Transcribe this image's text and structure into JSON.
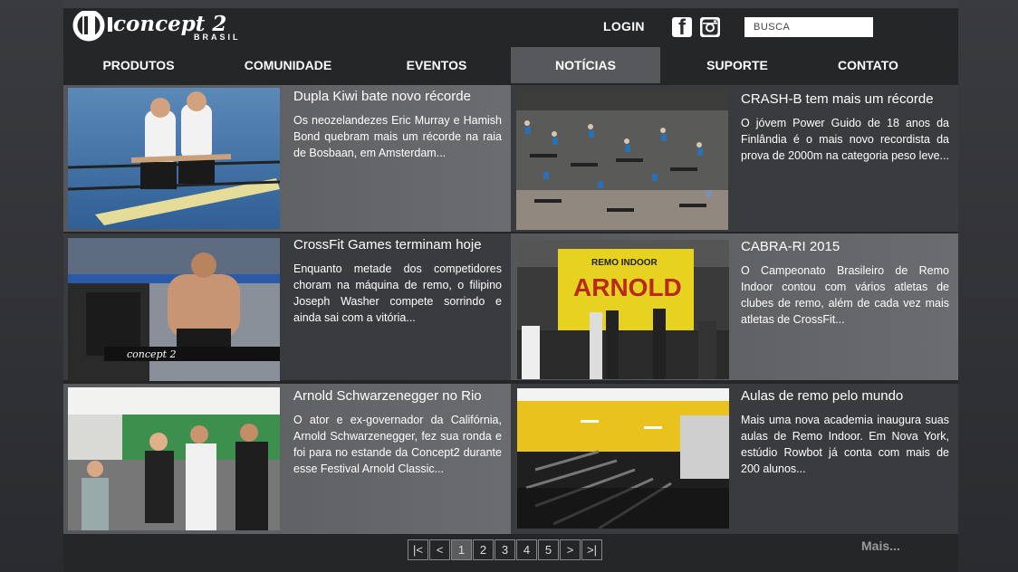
{
  "header": {
    "logo_text": "concept 2",
    "logo_sub": "BRASIL",
    "login_label": "LOGIN",
    "social_icons": [
      "facebook-icon",
      "instagram-icon"
    ],
    "search_placeholder": "BUSCA"
  },
  "nav": [
    {
      "label": "PRODUTOS",
      "active": false
    },
    {
      "label": "COMUNIDADE",
      "active": false
    },
    {
      "label": "EVENTOS",
      "active": false
    },
    {
      "label": "NOTÍCIAS",
      "active": true
    },
    {
      "label": "SUPORTE",
      "active": false
    },
    {
      "label": "CONTATO",
      "active": false
    }
  ],
  "news": [
    {
      "title": "Dupla Kiwi bate novo récorde",
      "excerpt": "Os neozelandezes Eric Murray e Hamish Bond quebram mais um récorde na raia de Bosbaan, em Amsterdam..."
    },
    {
      "title": "CRASH-B tem mais um récorde",
      "excerpt": "O jóvem Power Guido de 18 anos da Finlândia é o mais novo recordista da prova de 2000m na categoria peso leve..."
    },
    {
      "title": "CrossFit Games terminam hoje",
      "excerpt": "Enquanto metade dos competidores choram na máquina de remo, o filipino Joseph Washer compete sorrindo e ainda sai com a vitória..."
    },
    {
      "title": "CABRA-RI 2015",
      "excerpt": "O Campeonato Brasileiro de Remo Indoor contou com vários atletas de clubes de remo, além de cada vez mais atletas de CrossFit..."
    },
    {
      "title": "Arnold Schwarzenegger no Rio",
      "excerpt": "O ator e ex-governador da Califórnia, Arnold Schwarzenegger, fez sua ronda e foi para no estande da Concept2 durante esse Festival Arnold Classic..."
    },
    {
      "title": "Aulas de remo pelo mundo",
      "excerpt": "Mais uma nova academia inaugura suas aulas de Remo Indoor. Em Nova York, estúdio Rowbot já conta com mais de 200 alunos..."
    }
  ],
  "photo_texts": {
    "erg_brand": "concept 2",
    "banner_top": "REMO INDOOR",
    "banner_main": "ARNOLD"
  },
  "pagination": {
    "first": "|<",
    "prev": "<",
    "pages": [
      "1",
      "2",
      "3",
      "4",
      "5"
    ],
    "next": ">",
    "last": ">|",
    "current": "1"
  },
  "more_label": "Mais...",
  "colors": {
    "background": "#2f3033",
    "nav_active": "#57585c",
    "card_light": "#5f6064",
    "card_dark": "#3a3b3e"
  }
}
